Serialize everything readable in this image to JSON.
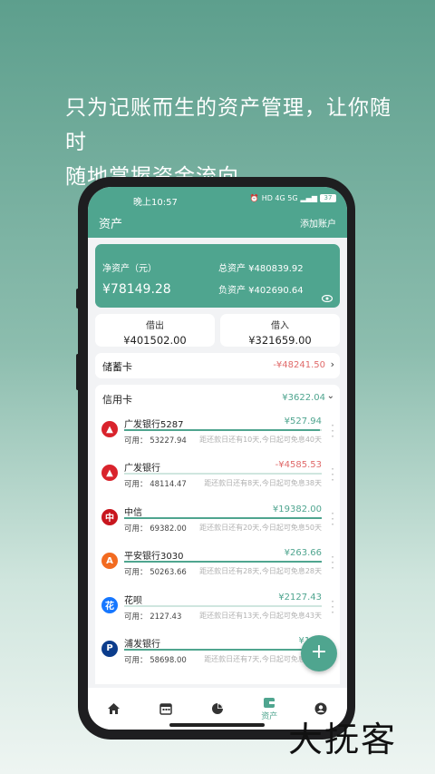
{
  "headline": [
    "只为记账而生的资产管理，让你随时",
    "随地掌握资金流向"
  ],
  "status": {
    "time": "晚上10:57",
    "icons_text": "HD 4G 5G",
    "battery": "37"
  },
  "appbar": {
    "title": "资产",
    "add_account": "添加账户"
  },
  "net_assets": {
    "label": "净资产（元）",
    "value": "¥78149.28",
    "total": "总资产 ¥480839.92",
    "liabilities": "负资产 ¥402690.64"
  },
  "lend": {
    "label": "借出",
    "value": "¥401502.00"
  },
  "borrow": {
    "label": "借入",
    "value": "¥321659.00"
  },
  "savings": {
    "name": "储蓄卡",
    "amount": "-¥48241.50",
    "color": "#e06a6a"
  },
  "credit": {
    "name": "信用卡",
    "amount": "¥3622.04",
    "banks": [
      {
        "name": "广发银行5287",
        "amount": "¥527.94",
        "amount_color": "#4fa58f",
        "avail": "可用：  53227.94",
        "due": "距还款日还有10天,今日起可免息40天",
        "progress": 0.99,
        "logo_color": "#d9232c",
        "logo_text": "▲"
      },
      {
        "name": "广发银行",
        "amount": "-¥4585.53",
        "amount_color": "#e06a6a",
        "avail": "可用：  48114.47",
        "due": "距还款日还有8天,今日起可免息38天",
        "progress": 0.0,
        "logo_color": "#d9232c",
        "logo_text": "▲"
      },
      {
        "name": "中信",
        "amount": "¥19382.00",
        "amount_color": "#4fa58f",
        "avail": "可用：  69382.00",
        "due": "距还款日还有20天,今日起可免息50天",
        "progress": 1.0,
        "logo_color": "#c8161e",
        "logo_text": "中"
      },
      {
        "name": "平安银行3030",
        "amount": "¥263.66",
        "amount_color": "#4fa58f",
        "avail": "可用：  50263.66",
        "due": "距还款日还有28天,今日起可免息28天",
        "progress": 1.0,
        "logo_color": "#f26b21",
        "logo_text": "A"
      },
      {
        "name": "花呗",
        "amount": "¥2127.43",
        "amount_color": "#4fa58f",
        "avail": "可用：  2127.43",
        "due": "距还款日还有13天,今日起可免息43天",
        "progress": 0.0,
        "logo_color": "#1677ff",
        "logo_text": "花"
      },
      {
        "name": "浦发银行",
        "amount": "¥198",
        "amount_color": "#4fa58f",
        "avail": "可用：  58698.00",
        "due": "距还款日还有7天,今日起可免息38天",
        "progress": 1.0,
        "logo_color": "#0b3c8c",
        "logo_text": "P"
      }
    ]
  },
  "tabbar": {
    "assets_label": "资产"
  },
  "watermark": "大抚客",
  "colors": {
    "accent": "#4fa58f",
    "negative": "#e06a6a"
  }
}
